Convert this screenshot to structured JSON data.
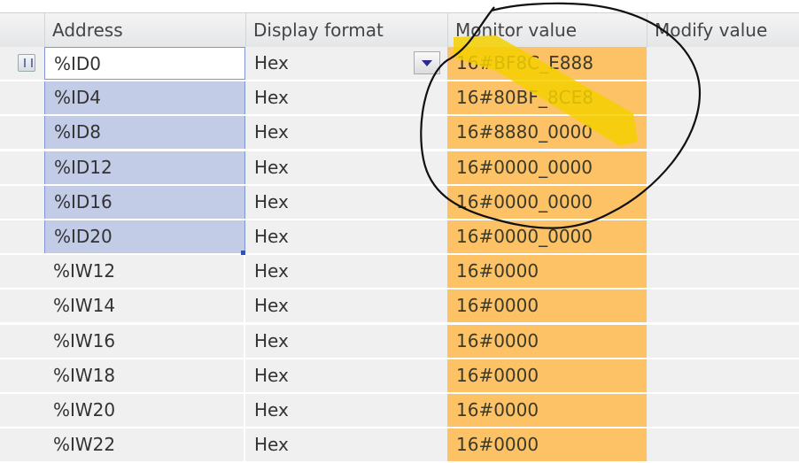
{
  "columns": [
    "",
    "Address",
    "Display format",
    "Monitor value",
    "Modify value"
  ],
  "rows": [
    {
      "address": "%ID0",
      "format": "Hex",
      "monitor": "16#BF8C_E888",
      "modify": ""
    },
    {
      "address": "%ID4",
      "format": "Hex",
      "monitor": "16#80BF_8CE8",
      "modify": ""
    },
    {
      "address": "%ID8",
      "format": "Hex",
      "monitor": "16#8880_0000",
      "modify": ""
    },
    {
      "address": "%ID12",
      "format": "Hex",
      "monitor": "16#0000_0000",
      "modify": ""
    },
    {
      "address": "%ID16",
      "format": "Hex",
      "monitor": "16#0000_0000",
      "modify": ""
    },
    {
      "address": "%ID20",
      "format": "Hex",
      "monitor": "16#0000_0000",
      "modify": ""
    },
    {
      "address": "%IW12",
      "format": "Hex",
      "monitor": "16#0000",
      "modify": ""
    },
    {
      "address": "%IW14",
      "format": "Hex",
      "monitor": "16#0000",
      "modify": ""
    },
    {
      "address": "%IW16",
      "format": "Hex",
      "monitor": "16#0000",
      "modify": ""
    },
    {
      "address": "%IW18",
      "format": "Hex",
      "monitor": "16#0000",
      "modify": ""
    },
    {
      "address": "%IW20",
      "format": "Hex",
      "monitor": "16#0000",
      "modify": ""
    },
    {
      "address": "%IW22",
      "format": "Hex",
      "monitor": "16#0000",
      "modify": ""
    }
  ],
  "colors": {
    "monitor_bg": "#fdc266",
    "selection": "#c3cce6",
    "highlighter": "#f5d000",
    "circle": "#111111"
  }
}
